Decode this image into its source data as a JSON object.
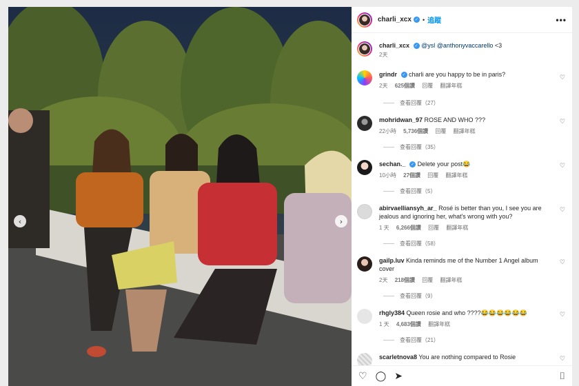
{
  "post": {
    "username": "charli_xcx",
    "separator": "•",
    "follow_label": "追蹤",
    "more_label": "•••",
    "caption_user": "charli_xcx",
    "caption_mentions": "@ysl @anthonyvaccarello",
    "caption_tail": " <3",
    "caption_time": "2天"
  },
  "photo": {
    "prev_label": "‹",
    "next_label": "›"
  },
  "comments": [
    {
      "user": "grindr",
      "verified": true,
      "text": "charli are you happy to be in paris?",
      "time": "2天",
      "likes": "625個讚",
      "reply": "回覆",
      "translate": "翻譯年糕",
      "view_replies": "查看回覆（27）"
    },
    {
      "user": "mohridwan_97",
      "verified": false,
      "text": "ROSE AND WHO ???",
      "time": "22小時",
      "likes": "5,736個讚",
      "reply": "回覆",
      "translate": "翻譯年糕",
      "view_replies": "查看回覆（35）"
    },
    {
      "user": "sechan._",
      "verified": true,
      "text": "Delete your post😂",
      "time": "10小時",
      "likes": "27個讚",
      "reply": "回覆",
      "translate": "翻譯年糕",
      "view_replies": "查看回覆（5）"
    },
    {
      "user": "abirvaelliansyh_ar_",
      "verified": false,
      "text": "Rosé is better than you, I see you are jealous and ignoring her, what's wrong with you?",
      "time": "1 天",
      "likes": "6,266個讚",
      "reply": "回覆",
      "translate": "翻譯年糕",
      "view_replies": "查看回覆（58）"
    },
    {
      "user": "gailp.luv",
      "verified": false,
      "text": "Kinda reminds me of the Number 1 Angel album cover",
      "time": "2天",
      "likes": "218個讚",
      "reply": "回覆",
      "translate": "翻譯年糕",
      "view_replies": "查看回覆（9）"
    },
    {
      "user": "rhgly384",
      "verified": false,
      "text": "Queen rosie and who ????😂😂😂😂😂😂",
      "time": "1 天",
      "likes": "4,683個讚",
      "reply": "回覆",
      "translate": "翻譯年糕",
      "view_replies": "查看回覆（21）"
    },
    {
      "user": "scarletnova8",
      "verified": false,
      "text": "You are nothing compared to Rosie"
    }
  ],
  "icons": {
    "heart": "♡",
    "like": "♡",
    "comment": "◯",
    "share": "➤",
    "save": "⌷"
  },
  "colors": {
    "accent": "#0095f6",
    "verified": "#3897f0",
    "muted": "#737373"
  }
}
